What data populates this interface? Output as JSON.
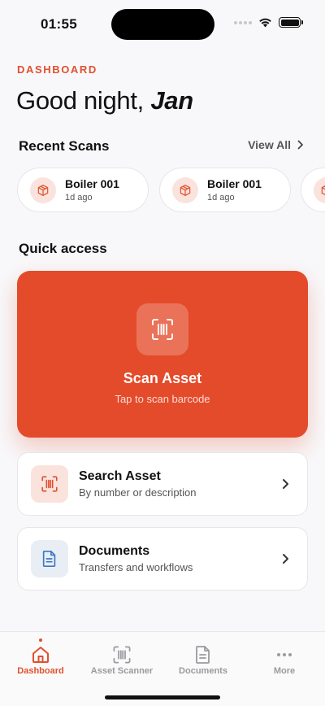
{
  "status_bar": {
    "time": "01:55"
  },
  "header": {
    "eyebrow": "DASHBOARD",
    "greeting": "Good night,",
    "user_name": "Jan"
  },
  "recent_scans": {
    "title": "Recent Scans",
    "view_all_label": "View All",
    "items": [
      {
        "title": "Boiler 001",
        "time_ago": "1d ago"
      },
      {
        "title": "Boiler 001",
        "time_ago": "1d ago"
      },
      {
        "title": "",
        "time_ago": ""
      }
    ]
  },
  "quick_access": {
    "title": "Quick access",
    "scan_card": {
      "title": "Scan Asset",
      "subtitle": "Tap to scan barcode",
      "icon": "barcode-scan-icon"
    },
    "actions": [
      {
        "title": "Search Asset",
        "subtitle": "By number or description",
        "icon": "barcode-scan-icon"
      },
      {
        "title": "Documents",
        "subtitle": "Transfers and workflows",
        "icon": "document-icon"
      }
    ]
  },
  "tab_bar": {
    "tabs": [
      {
        "label": "Dashboard",
        "icon": "home-icon",
        "active": true
      },
      {
        "label": "Asset Scanner",
        "icon": "barcode-scan-icon",
        "active": false
      },
      {
        "label": "Documents",
        "icon": "document-icon",
        "active": false
      },
      {
        "label": "More",
        "icon": "more-icon",
        "active": false
      }
    ]
  },
  "colors": {
    "accent": "#e44b2b",
    "accent_text": "#e0502f",
    "accent_tint": "#fbe3dd",
    "doc_tint": "#e9eef5",
    "doc_icon": "#3b78c4"
  }
}
